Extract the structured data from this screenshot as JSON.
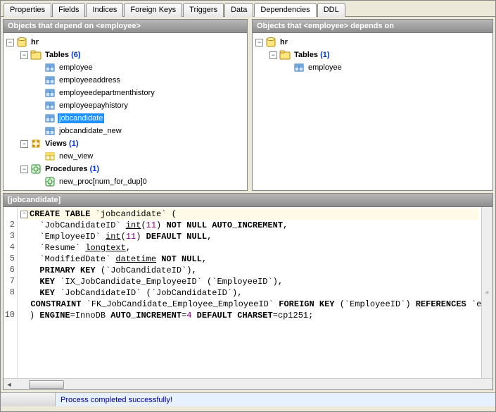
{
  "tabs": [
    "Properties",
    "Fields",
    "Indices",
    "Foreign Keys",
    "Triggers",
    "Data",
    "Dependencies",
    "DDL"
  ],
  "active_tab": 6,
  "left_pane_title": "Objects that depend on <employee>",
  "right_pane_title": "Objects that <employee> depends on",
  "left_tree": {
    "label": "hr",
    "groups": [
      {
        "label": "Tables",
        "count": "(6)",
        "items": [
          "employee",
          "employeeaddress",
          "employeedepartmenthistory",
          "employeepayhistory",
          "jobcandidate",
          "jobcandidate_new"
        ],
        "selected": 4
      },
      {
        "label": "Views",
        "count": "(1)",
        "items": [
          "new_view"
        ]
      },
      {
        "label": "Procedures",
        "count": "(1)",
        "items": [
          "new_proc[num_for_dup]0"
        ]
      }
    ]
  },
  "right_tree": {
    "label": "hr",
    "groups": [
      {
        "label": "Tables",
        "count": "(1)",
        "items": [
          "employee"
        ]
      }
    ]
  },
  "sql_title": "[jobcandidate]",
  "sql_lines": [
    "CREATE TABLE `jobcandidate` (",
    "  `JobCandidateID` int(11) NOT NULL AUTO_INCREMENT,",
    "  `EmployeeID` int(11) DEFAULT NULL,",
    "  `Resume` longtext,",
    "  `ModifiedDate` datetime NOT NULL,",
    "  PRIMARY KEY (`JobCandidateID`),",
    "  KEY `IX_JobCandidate_EmployeeID` (`EmployeeID`),",
    "  KEY `JobCandidateID` (`JobCandidateID`),",
    "  CONSTRAINT `FK_JobCandidate_Employee_EmployeeID` FOREIGN KEY (`EmployeeID`) REFERENCES `employee`",
    ") ENGINE=InnoDB AUTO_INCREMENT=4 DEFAULT CHARSET=cp1251;"
  ],
  "gutter": [
    "",
    "2",
    "3",
    "4",
    "5",
    "6",
    "7",
    "8",
    "",
    "10"
  ],
  "status": "Process completed successfully!"
}
